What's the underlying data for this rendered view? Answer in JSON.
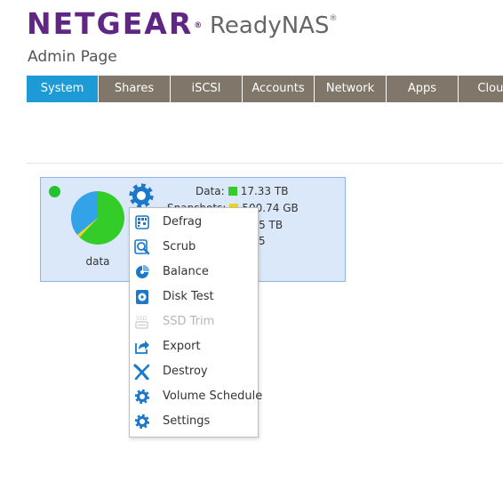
{
  "header": {
    "brand": "NETGEAR",
    "brand_mark": "®",
    "product": "ReadyNAS",
    "product_mark": "®",
    "page_title": "Admin Page"
  },
  "colors": {
    "brand": "#5f2683",
    "tab": "#807669",
    "tab_active": "#1e9bd7",
    "card_bg": "#dbe8f9",
    "card_border": "#8fb4e2",
    "status_ok": "#22c32e",
    "data_color": "#33cc29",
    "snapshots_color": "#e9d61d",
    "free_color": "#33a3e7",
    "icon_blue": "#1c79c9"
  },
  "tabs": [
    {
      "label": "System",
      "active": true
    },
    {
      "label": "Shares",
      "active": false
    },
    {
      "label": "iSCSI",
      "active": false
    },
    {
      "label": "Accounts",
      "active": false
    },
    {
      "label": "Network",
      "active": false
    },
    {
      "label": "Apps",
      "active": false
    },
    {
      "label": "Cloud",
      "active": false
    }
  ],
  "volume": {
    "name": "data",
    "status_icon": "green-status-dot",
    "gear_icon": "gear-icon",
    "usage_fractions": {
      "data": 0.62,
      "snapshots": 0.02,
      "free": 0.36
    },
    "data_label": "Data:",
    "data_value": "17.33 TB",
    "snapshots_label": "Snapshots:",
    "snapshots_value": "500.74 GB",
    "free_value": "...45 TB",
    "extra_value": "5"
  },
  "context_menu": {
    "items": [
      {
        "label": "Defrag",
        "icon": "defrag-icon",
        "disabled": false
      },
      {
        "label": "Scrub",
        "icon": "scrub-icon",
        "disabled": false
      },
      {
        "label": "Balance",
        "icon": "balance-icon",
        "disabled": false
      },
      {
        "label": "Disk Test",
        "icon": "disk-test-icon",
        "disabled": false
      },
      {
        "label": "SSD Trim",
        "icon": "ssd-trim-icon",
        "disabled": true
      },
      {
        "label": "Export",
        "icon": "export-icon",
        "disabled": false
      },
      {
        "label": "Destroy",
        "icon": "destroy-icon",
        "disabled": false
      },
      {
        "label": "Volume Schedule",
        "icon": "gear-icon",
        "disabled": false
      },
      {
        "label": "Settings",
        "icon": "gear-icon",
        "disabled": false
      }
    ]
  }
}
